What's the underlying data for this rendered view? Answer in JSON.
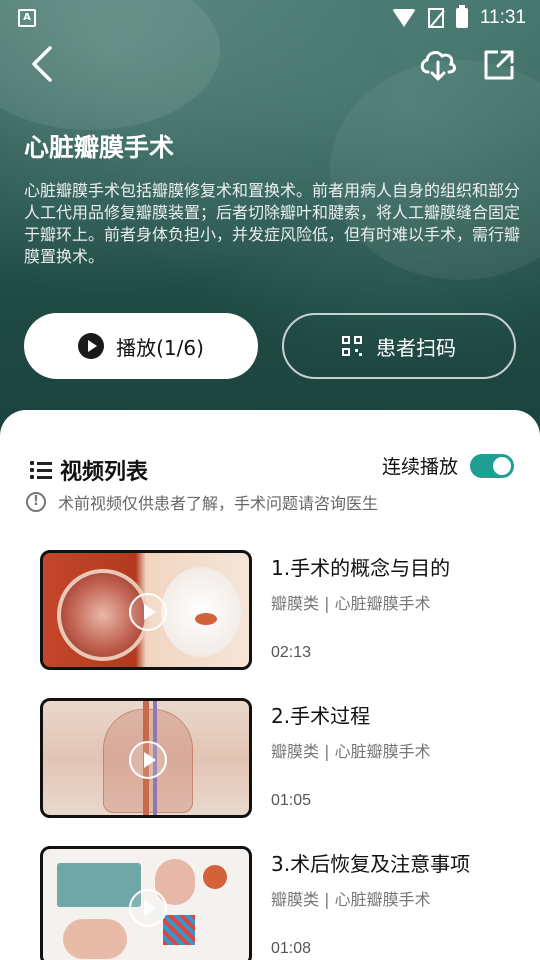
{
  "status_bar": {
    "time": "11:31",
    "app_badge": "A"
  },
  "header": {
    "title": "心脏瓣膜手术",
    "description": "心脏瓣膜手术包括瓣膜修复术和置换术。前者用病人自身的组织和部分人工代用品修复瓣膜装置；后者切除瓣叶和腱索，将人工瓣膜缝合固定于瓣环上。前者身体负担小，并发症风险低，但有时难以手术，需行瓣膜置换术。",
    "play_button": "播放(1/6)",
    "scan_button": "患者扫码"
  },
  "list": {
    "title": "视频列表",
    "continuous_label": "连续播放",
    "continuous_on": true,
    "notice": "术前视频仅供患者了解，手术问题请咨询医生",
    "videos": [
      {
        "title": "1.手术的概念与目的",
        "category": "瓣膜类 | 心脏瓣膜手术",
        "duration": "02:13"
      },
      {
        "title": "2.手术过程",
        "category": "瓣膜类 | 心脏瓣膜手术",
        "duration": "01:05"
      },
      {
        "title": "3.术后恢复及注意事项",
        "category": "瓣膜类 | 心脏瓣膜手术",
        "duration": "01:08"
      }
    ]
  },
  "colors": {
    "accent": "#1f9e94",
    "hero": "#2b5a52"
  }
}
